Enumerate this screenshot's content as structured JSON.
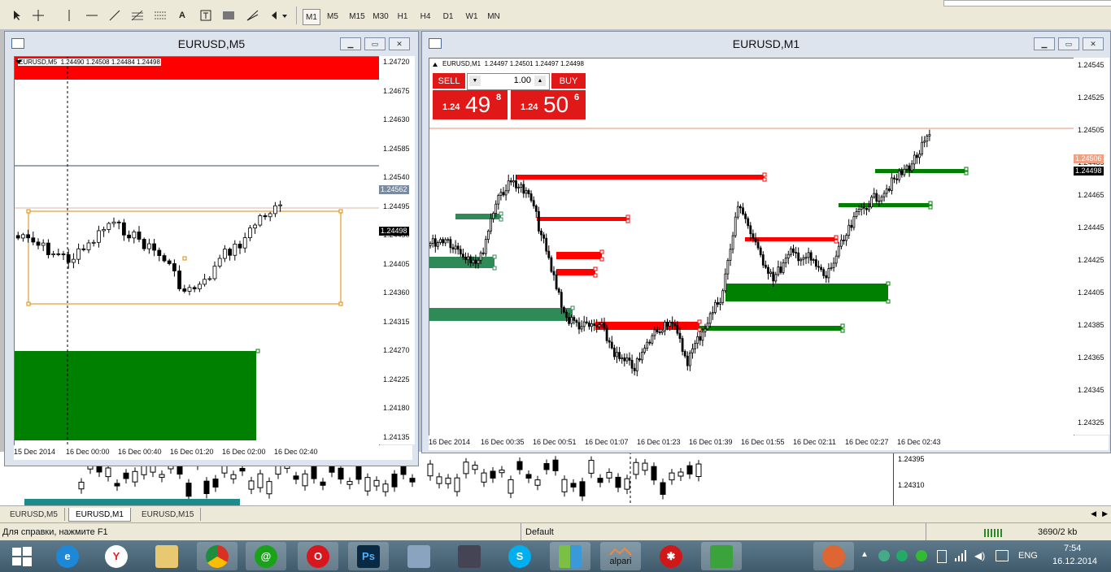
{
  "toolbar": {
    "timeframes": [
      "M1",
      "M5",
      "M15",
      "M30",
      "H1",
      "H4",
      "D1",
      "W1",
      "MN"
    ],
    "selected_timeframe": "M1",
    "tools": [
      "cursor-icon",
      "crosshair-icon",
      "vertical-line-icon",
      "horizontal-line-icon",
      "trendline-icon",
      "fibonacci-icon",
      "fibonacci-fan-icon",
      "text-icon",
      "text-label-icon",
      "rectangle-icon",
      "gann-icon",
      "arrows-icon"
    ]
  },
  "window_left": {
    "title": "EURUSD,M5",
    "ohlc_label": "EURUSD,M5  1.24490 1.24508 1.24484 1.24498",
    "price_ticks": [
      "1.24720",
      "1.24675",
      "1.24630",
      "1.24585",
      "1.24540",
      "1.24495",
      "1.24450",
      "1.24405",
      "1.24360",
      "1.24315",
      "1.24270",
      "1.24225",
      "1.24180",
      "1.24135"
    ],
    "current_price": "1.24498",
    "line_price": "1.24562",
    "time_ticks": [
      "15 Dec 2014",
      "16 Dec 00:00",
      "16 Dec 00:40",
      "16 Dec 01:20",
      "16 Dec 02:00",
      "16 Dec 02:40"
    ],
    "colors": {
      "bull": "#ffffff",
      "bear": "#000000",
      "supply": "#ff0000",
      "demand": "#008000",
      "rect": "#e08a00",
      "hline": "#5a6e8c"
    }
  },
  "window_right": {
    "title": "EURUSD,M1",
    "ohlc_label": "EURUSD,M1  1.24497 1.24501 1.24497 1.24498",
    "sell_label": "SELL",
    "buy_label": "BUY",
    "lot": "1.00",
    "sell_price_small": "1.24",
    "sell_price_big": "49",
    "sell_price_sup": "8",
    "buy_price_small": "1.24",
    "buy_price_big": "50",
    "buy_price_sup": "6",
    "price_ticks": [
      "1.24545",
      "1.24525",
      "1.24505",
      "1.24485",
      "1.24465",
      "1.24445",
      "1.24425",
      "1.24405",
      "1.24385",
      "1.24365",
      "1.24345",
      "1.24325"
    ],
    "current_price": "1.24498",
    "ask_price": "1.24506",
    "time_ticks": [
      "16 Dec 2014",
      "16 Dec 00:35",
      "16 Dec 00:51",
      "16 Dec 01:07",
      "16 Dec 01:23",
      "16 Dec 01:39",
      "16 Dec 01:55",
      "16 Dec 02:11",
      "16 Dec 02:27",
      "16 Dec 02:43"
    ],
    "colors": {
      "supply": "#ff0000",
      "demand": "#008000",
      "demand_old": "#2e8b57",
      "ask_line": "#e89070"
    }
  },
  "background_chart": {
    "price_ticks": [
      "1.24395",
      "1.24310"
    ]
  },
  "tabs": [
    "EURUSD,M5",
    "EURUSD,M1",
    "EURUSD,M15"
  ],
  "active_tab": "EURUSD,M1",
  "statusbar": {
    "help": "Для справки, нажмите F1",
    "profile": "Default",
    "traffic": "3690/2 kb"
  },
  "taskbar": {
    "apps": [
      "windows-start-icon",
      "ie-icon",
      "yandex-browser-icon",
      "file-explorer-icon",
      "chrome-icon",
      "mail-agent-icon",
      "opera-icon",
      "photoshop-icon",
      "network-icon",
      "counter-strike-icon",
      "skype-icon",
      "app-icon",
      "alpari-icon",
      "settings-app-icon",
      "metatrader-icon",
      "app2-icon"
    ],
    "alpari_label": "alpari",
    "lang": "ENG",
    "time": "7:54",
    "date": "16.12.2014"
  }
}
